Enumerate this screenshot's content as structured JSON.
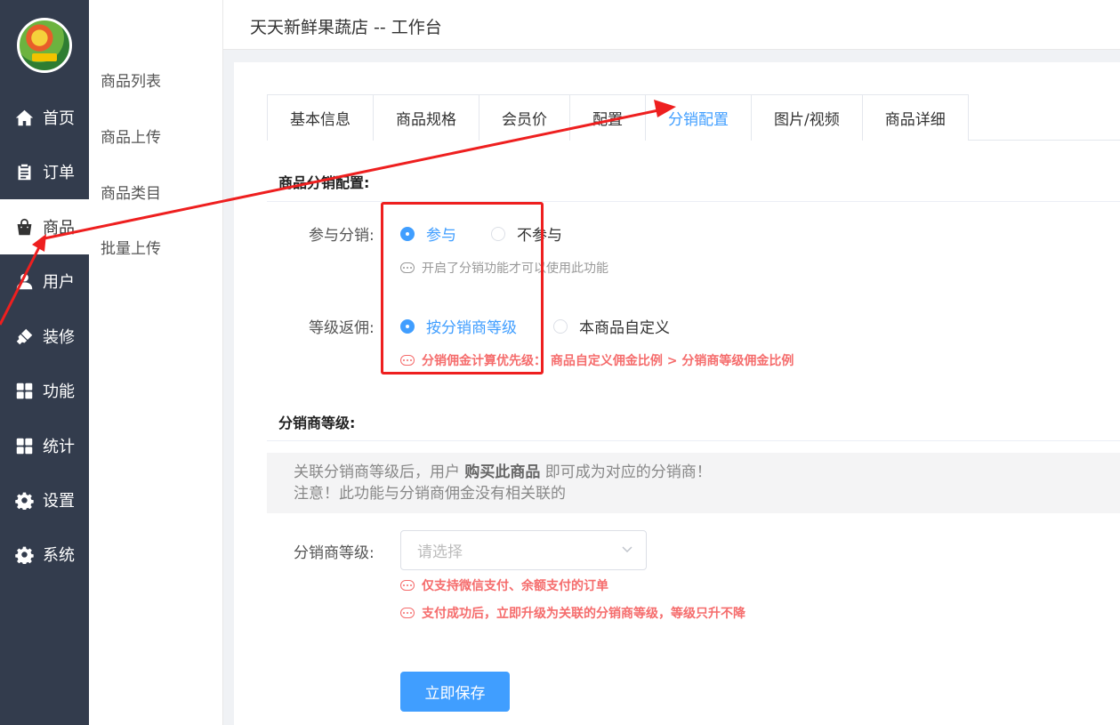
{
  "app": {
    "store_title": "天天新鲜果蔬店 -- 工作台"
  },
  "nav": {
    "items": [
      {
        "label": "首页",
        "icon": "home-icon"
      },
      {
        "label": "订单",
        "icon": "clipboard-icon"
      },
      {
        "label": "商品",
        "icon": "shopping-bag-icon"
      },
      {
        "label": "用户",
        "icon": "user-icon"
      },
      {
        "label": "装修",
        "icon": "brush-icon"
      },
      {
        "label": "功能",
        "icon": "grid-icon"
      },
      {
        "label": "统计",
        "icon": "grid-icon"
      },
      {
        "label": "设置",
        "icon": "gear-icon"
      },
      {
        "label": "系统",
        "icon": "gear-icon"
      }
    ],
    "active_index": 2
  },
  "submenu": {
    "items": [
      "商品列表",
      "商品上传",
      "商品类目",
      "批量上传"
    ]
  },
  "tabs": {
    "items": [
      "基本信息",
      "商品规格",
      "会员价",
      "配置",
      "分销配置",
      "图片/视频",
      "商品详细"
    ],
    "active_index": 4
  },
  "distribution_config": {
    "section_title": "商品分销配置:",
    "participate": {
      "label": "参与分销:",
      "options": [
        "参与",
        "不参与"
      ],
      "selected": "参与",
      "hint": "开启了分销功能才可以使用此功能"
    },
    "commission": {
      "label": "等级返佣:",
      "options": [
        "按分销商等级",
        "本商品自定义"
      ],
      "selected": "按分销商等级",
      "hint": "分销佣金计算优先级： 商品自定义佣金比例 > 分销商等级佣金比例"
    }
  },
  "distributor_level": {
    "section_title": "分销商等级:",
    "notice_line1_prefix": "关联分销商等级后，用户 ",
    "notice_line1_bold": "购买此商品",
    "notice_line1_suffix": " 即可成为对应的分销商！",
    "notice_line2": "注意！此功能与分销商佣金没有相关联的",
    "field_label": "分销商等级:",
    "select_placeholder": "请选择",
    "hint1": "仅支持微信支付、余额支付的订单",
    "hint2": "支付成功后，立即升级为关联的分销商等级，等级只升不降"
  },
  "actions": {
    "save_label": "立即保存"
  },
  "colors": {
    "sidebar_bg": "#333c4d",
    "primary": "#409eff",
    "danger": "#f56c6c",
    "annotation": "#ee1f1f"
  }
}
